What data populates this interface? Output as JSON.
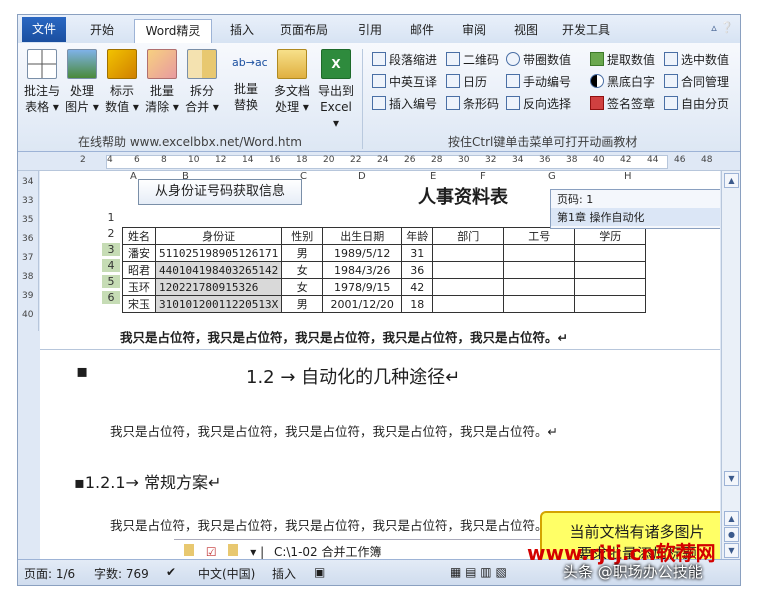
{
  "tabs": [
    "文件",
    "开始",
    "Word精灵",
    "插入",
    "页面布局",
    "引用",
    "邮件",
    "审阅",
    "视图",
    "开发工具"
  ],
  "ribbon": {
    "big_buttons": [
      {
        "label1": "批注与",
        "label2": "表格 ▾"
      },
      {
        "label1": "处理",
        "label2": "图片 ▾"
      },
      {
        "label1": "标示",
        "label2": "数值 ▾"
      },
      {
        "label1": "批量",
        "label2": "清除 ▾"
      },
      {
        "label1": "拆分",
        "label2": "合并 ▾"
      },
      {
        "label1": "批量",
        "label2": "替换"
      },
      {
        "label1": "多文档",
        "label2": "处理 ▾"
      },
      {
        "label1": "导出到",
        "label2": "Excel ▾"
      }
    ],
    "group1_label": "在线帮助  www.excelbbx.net/Word.htm",
    "small_col1": [
      "段落缩进",
      "中英互译",
      "插入编号"
    ],
    "small_col2": [
      "二维码",
      "日历",
      "条形码"
    ],
    "small_col3": [
      "带圈数值",
      "手动编号",
      "反向选择"
    ],
    "small_col4": [
      "提取数值",
      "黑底白字",
      "签名签章"
    ],
    "small_col5": [
      "选中数值",
      "合同管理",
      "自由分页"
    ],
    "group2_label": "按住Ctrl键单击菜单可打开动画教材"
  },
  "ruler_ticks": [
    "2",
    "4",
    "6",
    "8",
    "10",
    "12",
    "14",
    "16",
    "18",
    "20",
    "22",
    "24",
    "26",
    "28",
    "30",
    "32",
    "34",
    "36",
    "38",
    "40",
    "42",
    "44",
    "46",
    "48"
  ],
  "vruler_ticks": [
    "34",
    "33",
    "35",
    "36",
    "37",
    "38",
    "39",
    "40"
  ],
  "excel": {
    "col_headers": [
      "A",
      "B",
      "C",
      "D",
      "E",
      "F",
      "G",
      "H"
    ],
    "button_label": "从身份证号码获取信息",
    "title": "人事资料表",
    "headers": [
      "姓名",
      "身份证",
      "性别",
      "出生日期",
      "年龄",
      "部门",
      "工号",
      "学历"
    ],
    "rows": [
      [
        "潘安",
        "511025198905126171",
        "男",
        "1989/5/12",
        "31",
        "",
        "",
        ""
      ],
      [
        "昭君",
        "440104198403265142",
        "女",
        "1984/3/26",
        "36",
        "",
        "",
        ""
      ],
      [
        "玉环",
        "120221780915326",
        "女",
        "1978/9/15",
        "42",
        "",
        "",
        ""
      ],
      [
        "宋玉",
        "31010120011220513X",
        "男",
        "2001/12/20",
        "18",
        "",
        "",
        ""
      ]
    ],
    "row_numbers": [
      "1",
      "2",
      "3",
      "4",
      "5",
      "6"
    ]
  },
  "tooltip": {
    "line1": "页码: 1",
    "line2": "第1章 操作自动化"
  },
  "doc": {
    "placeholder1": "我只是占位符，我只是占位符，我只是占位符，我只是占位符，我只是占位符。↵",
    "heading1": "1.2 → 自动化的几种途径↵",
    "placeholder2": "我只是占位符，我只是占位符，我只是占位符，我只是占位符，我只是占位符。↵",
    "heading2": "1.2.1→ 常规方案↵",
    "placeholder3": "我只是占位符，我只是占位符，我只是占位符，我只是占位符，我只是占位符。↵",
    "explorer_path": "C:\\1-02 合并工作簿"
  },
  "callout": {
    "line1": "当前文档有诸多图片",
    "line2": "要求批量添加标题"
  },
  "status": {
    "page": "页面: 1/6",
    "words": "字数: 769",
    "lang": "中文(中国)",
    "mode": "插入"
  },
  "watermark": {
    "line1": "www.rjtj.cn软荐网",
    "line2": "头条 @职场办公技能"
  },
  "colors": {
    "file_tab": "#1a4fa0",
    "callout": "#ffff66",
    "watermark": "#d30000"
  }
}
